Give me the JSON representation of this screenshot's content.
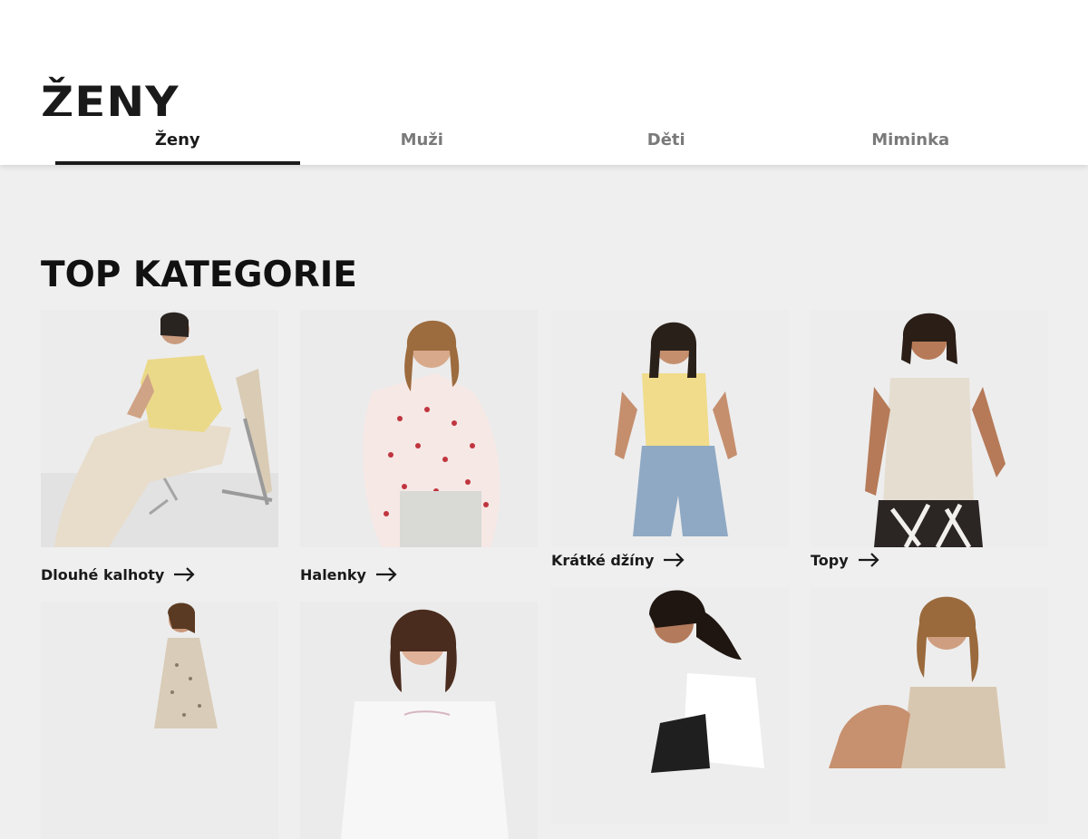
{
  "header": {
    "title": "ŽENY",
    "tabs": [
      {
        "label": "Ženy",
        "active": true
      },
      {
        "label": "Muži",
        "active": false
      },
      {
        "label": "Děti",
        "active": false
      },
      {
        "label": "Miminka",
        "active": false
      }
    ]
  },
  "main": {
    "section_title": "TOP KATEGORIE",
    "categories": [
      {
        "label": "Dlouhé kalhoty",
        "icon": "arrow-right-icon"
      },
      {
        "label": "Halenky",
        "icon": "arrow-right-icon"
      },
      {
        "label": "Krátké džíny",
        "icon": "arrow-right-icon"
      },
      {
        "label": "Topy",
        "icon": "arrow-right-icon"
      }
    ]
  },
  "colors": {
    "background": "#efefef",
    "header_background": "#ffffff",
    "text": "#1a1a1a",
    "inactive_tab": "#7a7a7a"
  }
}
